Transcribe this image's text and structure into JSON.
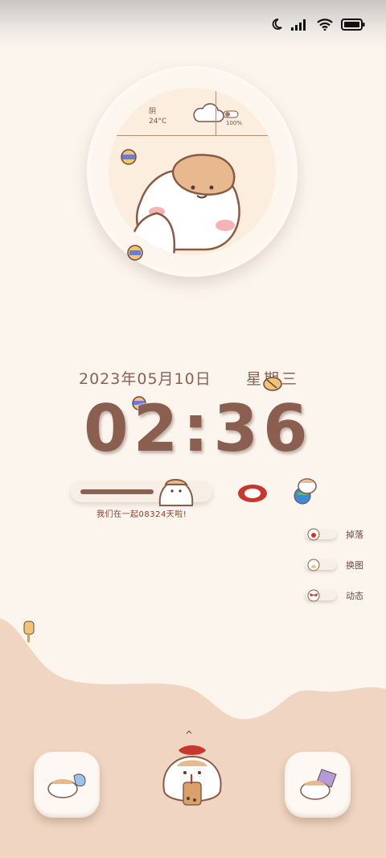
{
  "status_bar": {
    "icons": [
      "moon-icon",
      "signal-icon",
      "wifi-icon",
      "battery-icon"
    ]
  },
  "weather": {
    "condition": "阴",
    "temperature": "24°C",
    "icon": "cloud-icon",
    "battery_text": "100%"
  },
  "clock": {
    "date": "2023年05月10日",
    "weekday": "星期三",
    "time": "02:36"
  },
  "together": {
    "text": "我们在一起08324天啦!",
    "progress": 0.6
  },
  "side_menu": [
    {
      "label": "掉落",
      "icon": "hamster-red-icon"
    },
    {
      "label": "换图",
      "icon": "hamster-bee-icon"
    },
    {
      "label": "动态",
      "icon": "hamster-bow-icon"
    }
  ],
  "dock": {
    "left_icon": "hamster-lying-icon",
    "center_icon": "hamster-boba-icon",
    "right_icon": "hamster-envelope-icon",
    "swipe_glyph": "^"
  },
  "colors": {
    "background": "#fbf5ee",
    "wave": "#f0d6c2",
    "text_brown": "#8a6253",
    "accent_red": "#c8372d"
  }
}
